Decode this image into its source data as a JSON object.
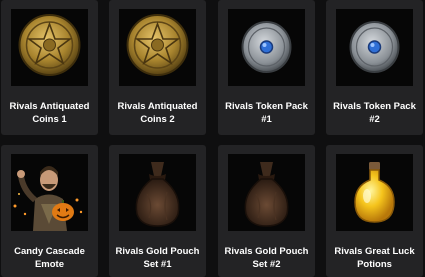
{
  "items": [
    {
      "label": "Rivals Antiquated Coins 1",
      "icon": "gold-coin-icon"
    },
    {
      "label": "Rivals Antiquated Coins 2",
      "icon": "gold-coin-icon"
    },
    {
      "label": "Rivals Token Pack #1",
      "icon": "silver-token-icon"
    },
    {
      "label": "Rivals Token Pack #2",
      "icon": "silver-token-icon"
    },
    {
      "label": "Candy Cascade Emote",
      "icon": "emote-character-icon"
    },
    {
      "label": "Rivals Gold Pouch Set #1",
      "icon": "gold-pouch-icon"
    },
    {
      "label": "Rivals Gold Pouch Set #2",
      "icon": "gold-pouch-icon"
    },
    {
      "label": "Rivals Great Luck Potions",
      "icon": "potion-flask-icon"
    }
  ]
}
